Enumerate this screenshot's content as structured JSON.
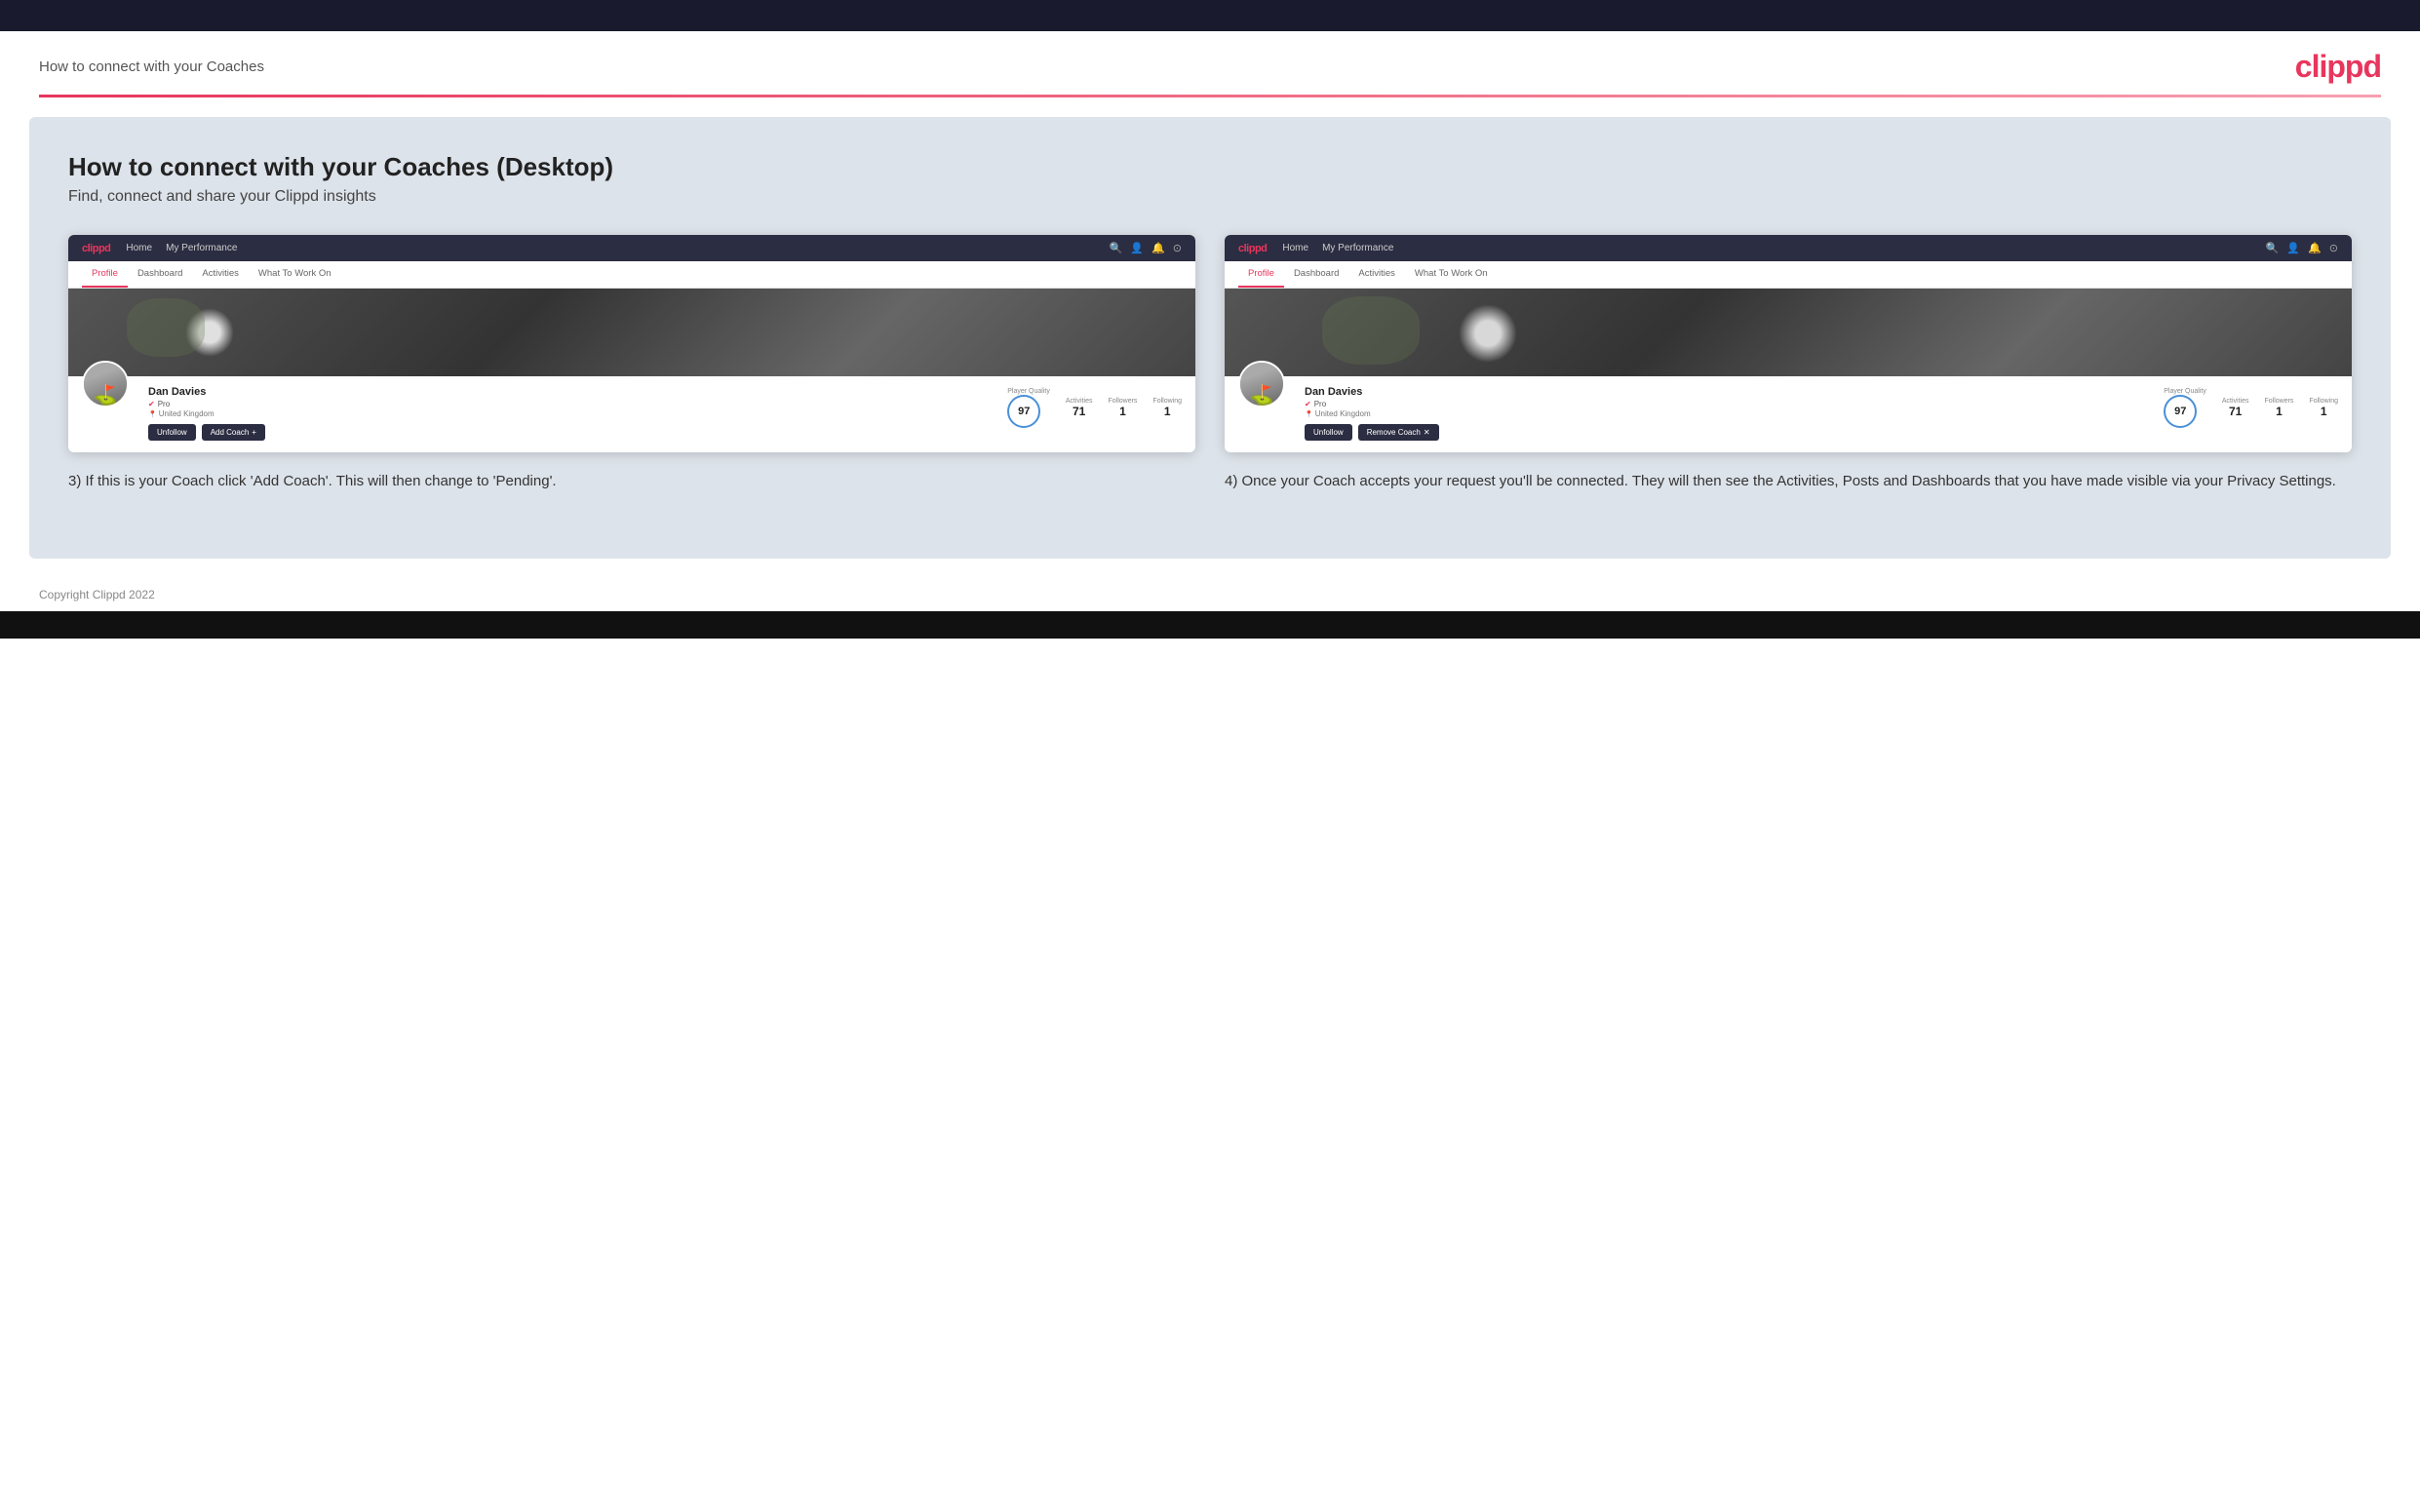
{
  "topBar": {},
  "header": {
    "title": "How to connect with your Coaches",
    "logo": "clippd"
  },
  "mainContent": {
    "heading": "How to connect with your Coaches (Desktop)",
    "subheading": "Find, connect and share your Clippd insights"
  },
  "screenshot1": {
    "nav": {
      "logo": "clippd",
      "links": [
        "Home",
        "My Performance"
      ],
      "tabs": [
        "Profile",
        "Dashboard",
        "Activities",
        "What To Work On"
      ],
      "activeTab": "Profile"
    },
    "profile": {
      "name": "Dan Davies",
      "pro": "Pro",
      "location": "United Kingdom",
      "playerQualityLabel": "Player Quality",
      "playerQuality": "97",
      "activitiesLabel": "Activities",
      "activities": "71",
      "followersLabel": "Followers",
      "followers": "1",
      "followingLabel": "Following",
      "following": "1",
      "unfollowBtn": "Unfollow",
      "addCoachBtn": "Add Coach"
    },
    "description": "3) If this is your Coach click 'Add Coach'. This will then change to 'Pending'."
  },
  "screenshot2": {
    "nav": {
      "logo": "clippd",
      "links": [
        "Home",
        "My Performance"
      ],
      "tabs": [
        "Profile",
        "Dashboard",
        "Activities",
        "What To Work On"
      ],
      "activeTab": "Profile"
    },
    "profile": {
      "name": "Dan Davies",
      "pro": "Pro",
      "location": "United Kingdom",
      "playerQualityLabel": "Player Quality",
      "playerQuality": "97",
      "activitiesLabel": "Activities",
      "activities": "71",
      "followersLabel": "Followers",
      "followers": "1",
      "followingLabel": "Following",
      "following": "1",
      "unfollowBtn": "Unfollow",
      "removeCoachBtn": "Remove Coach"
    },
    "description": "4) Once your Coach accepts your request you'll be connected. They will then see the Activities, Posts and Dashboards that you have made visible via your Privacy Settings."
  },
  "footer": {
    "copyright": "Copyright Clippd 2022"
  }
}
